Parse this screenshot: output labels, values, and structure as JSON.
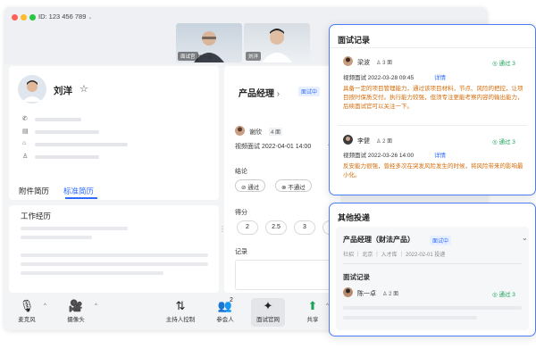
{
  "window": {
    "meeting_id": "ID: 123 456 789",
    "colors": {
      "close": "#ff5f57",
      "min": "#febc2e",
      "max": "#28c840",
      "accent": "#2f6bff",
      "pass": "#1aa35a",
      "orange_text": "#d46b08"
    }
  },
  "videos": [
    {
      "tag": "面试官",
      "name": "陈一卓"
    },
    {
      "tag": "刘洋"
    }
  ],
  "profile": {
    "name": "刘洋",
    "star_icon": "☆",
    "info_icons": [
      "phone-icon",
      "id-card-icon",
      "graduation-cap-icon",
      "user-icon"
    ],
    "tabs": [
      "附件简历",
      "标准简历"
    ],
    "work_title": "工作经历"
  },
  "interview": {
    "job_title": "产品经理",
    "status": "面试中",
    "interviewer": "谢欣",
    "round": "4 面",
    "type_time": "视频面试 2022-04-01 14:00",
    "detail": "详",
    "conclusion_label": "结论",
    "pass_label": "通过",
    "fail_label": "不通过",
    "score_label": "得分",
    "scores": [
      "2",
      "2.5",
      "3",
      "3"
    ],
    "record_label": "记录"
  },
  "toolbar": {
    "items": [
      {
        "label": "麦克风",
        "icon": "microphone-icon",
        "glyph": "🎙"
      },
      {
        "label": "摄像头",
        "icon": "camera-icon",
        "glyph": "🎥"
      },
      {
        "label": "主持人控制",
        "icon": "host-control-icon",
        "glyph": "⇅"
      },
      {
        "label": "参会人",
        "icon": "participants-icon",
        "glyph": "👥",
        "count": "2"
      },
      {
        "label": "面试官网",
        "icon": "interview-icon",
        "glyph": "✦"
      },
      {
        "label": "共享",
        "icon": "share-icon",
        "glyph": "⬆"
      }
    ]
  },
  "records_card": {
    "title": "面试记录",
    "records": [
      {
        "name": "梁波",
        "round": "3 面",
        "pass": "通过 3",
        "type_time": "视频面试 2022-03-28 09:45",
        "detail": "详情",
        "comment": "具备一定的项目管理能力，通过该项目材料，节点、风险的把控，让项目按时保质交付。执行能力较强，但须专注更能考察内容的输出能力，后续面试官可以关注一下。"
      },
      {
        "name": "李健",
        "round": "2 面",
        "pass": "通过 3",
        "type_time": "视频面试 2022-03-26 14:00",
        "detail": "详情",
        "comment": "反安能力很强，曾经多次在突发风险发生的时候，将风险带来的影响最小化。"
      }
    ]
  },
  "other_card": {
    "title": "其他投递",
    "job_title": "产品经理（财法产品）",
    "status": "面试中",
    "meta": "社招 ｜ 北京 ｜ 入才库 ｜ 2022-02-01 投递",
    "records_title": "面试记录",
    "interviewer": "陈一卓",
    "round": "2 面",
    "pass": "通过 3"
  }
}
